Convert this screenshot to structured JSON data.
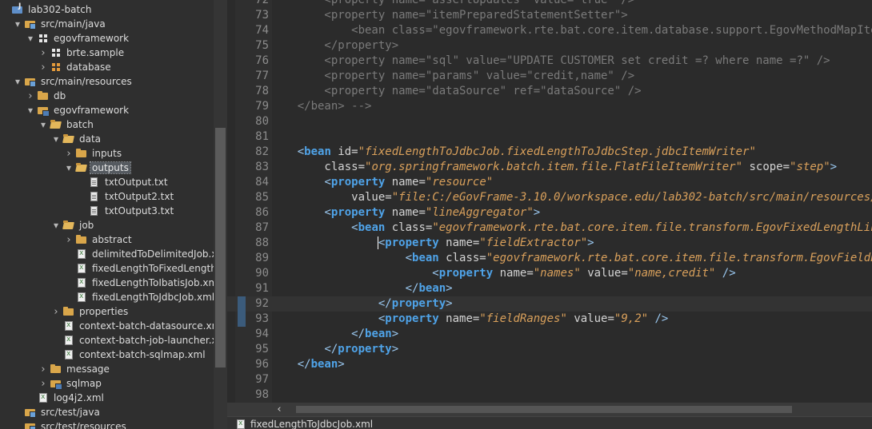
{
  "explorer": {
    "rows": [
      {
        "label": "lab302-batch",
        "icon": "project-icon",
        "twisty": "none",
        "depth": 0
      },
      {
        "label": "src/main/java",
        "icon": "srcfolder-icon",
        "twisty": "expanded",
        "depth": 1
      },
      {
        "label": "egovframework",
        "icon": "package-icon",
        "twisty": "expanded",
        "depth": 2
      },
      {
        "label": "brte.sample",
        "icon": "package-icon",
        "twisty": "collapsed",
        "depth": 3
      },
      {
        "label": "database",
        "icon": "pkg-orange-icon",
        "twisty": "collapsed",
        "depth": 3
      },
      {
        "label": "src/main/resources",
        "icon": "srcfolder-icon",
        "twisty": "expanded",
        "depth": 1
      },
      {
        "label": "db",
        "icon": "folder-icon",
        "twisty": "collapsed",
        "depth": 2
      },
      {
        "label": "egovframework",
        "icon": "linkedfolder-icon",
        "twisty": "expanded",
        "depth": 2
      },
      {
        "label": "batch",
        "icon": "folder-open-icon",
        "twisty": "expanded",
        "depth": 3
      },
      {
        "label": "data",
        "icon": "folder-open-icon",
        "twisty": "expanded",
        "depth": 4
      },
      {
        "label": "inputs",
        "icon": "folder-icon",
        "twisty": "collapsed",
        "depth": 5
      },
      {
        "label": "outputs",
        "icon": "folder-open-icon",
        "twisty": "expanded",
        "depth": 5,
        "selected": true
      },
      {
        "label": "txtOutput.txt",
        "icon": "file-icon",
        "twisty": "none",
        "depth": 6
      },
      {
        "label": "txtOutput2.txt",
        "icon": "file-icon",
        "twisty": "none",
        "depth": 6
      },
      {
        "label": "txtOutput3.txt",
        "icon": "file-icon",
        "twisty": "none",
        "depth": 6
      },
      {
        "label": "job",
        "icon": "folder-open-icon",
        "twisty": "expanded",
        "depth": 4
      },
      {
        "label": "abstract",
        "icon": "folder-icon",
        "twisty": "collapsed",
        "depth": 5
      },
      {
        "label": "delimitedToDelimitedJob.xml",
        "icon": "xml-icon",
        "twisty": "none",
        "depth": 5
      },
      {
        "label": "fixedLengthToFixedLengthJob",
        "icon": "xml-icon",
        "twisty": "none",
        "depth": 5
      },
      {
        "label": "fixedLengthToIbatisJob.xml",
        "icon": "xml-icon",
        "twisty": "none",
        "depth": 5
      },
      {
        "label": "fixedLengthToJdbcJob.xml",
        "icon": "xml-icon",
        "twisty": "none",
        "depth": 5
      },
      {
        "label": "properties",
        "icon": "folder-icon",
        "twisty": "collapsed",
        "depth": 4
      },
      {
        "label": "context-batch-datasource.xml",
        "icon": "xml-icon",
        "twisty": "none",
        "depth": 4
      },
      {
        "label": "context-batch-job-launcher.xml",
        "icon": "xml-icon",
        "twisty": "none",
        "depth": 4
      },
      {
        "label": "context-batch-sqlmap.xml",
        "icon": "xml-icon",
        "twisty": "none",
        "depth": 4
      },
      {
        "label": "message",
        "icon": "folder-icon",
        "twisty": "collapsed",
        "depth": 3
      },
      {
        "label": "sqlmap",
        "icon": "linkedfolder-icon",
        "twisty": "collapsed",
        "depth": 3
      },
      {
        "label": "log4j2.xml",
        "icon": "xml-icon",
        "twisty": "none",
        "depth": 2
      },
      {
        "label": "src/test/java",
        "icon": "srcfolder-icon",
        "twisty": "none",
        "depth": 1
      },
      {
        "label": "src/test/resources",
        "icon": "srcfolder-icon",
        "twisty": "none",
        "depth": 1
      }
    ]
  },
  "editor": {
    "current_line": 92,
    "changed_lines": [
      92,
      93
    ],
    "lines": [
      {
        "n": "72",
        "tokens": [
          [
            "c-comment",
            "        <property name=\"assertUpdates\" value=\"true\" />"
          ]
        ]
      },
      {
        "n": "73",
        "tokens": [
          [
            "c-comment",
            "        <property name=\"itemPreparedStatementSetter\">"
          ]
        ]
      },
      {
        "n": "74",
        "tokens": [
          [
            "c-comment",
            "            <bean class=\"egovframework.rte.bat.core.item.database.support.EgovMethodMapItem"
          ]
        ]
      },
      {
        "n": "75",
        "tokens": [
          [
            "c-comment",
            "        </property>"
          ]
        ]
      },
      {
        "n": "76",
        "tokens": [
          [
            "c-comment",
            "        <property name=\"sql\" value=\"UPDATE CUSTOMER set credit =? where name =?\" />"
          ]
        ]
      },
      {
        "n": "77",
        "tokens": [
          [
            "c-comment",
            "        <property name=\"params\" value=\"credit,name\" />"
          ]
        ]
      },
      {
        "n": "78",
        "tokens": [
          [
            "c-comment",
            "        <property name=\"dataSource\" ref=\"dataSource\" />"
          ]
        ]
      },
      {
        "n": "79",
        "tokens": [
          [
            "c-comment",
            "    </bean> -->"
          ]
        ]
      },
      {
        "n": "80",
        "tokens": []
      },
      {
        "n": "81",
        "tokens": []
      },
      {
        "n": "82",
        "tokens": [
          [
            "c-attr",
            "    "
          ],
          [
            "c-punct",
            "<"
          ],
          [
            "c-tag",
            "bean"
          ],
          [
            "c-attr",
            " id="
          ],
          [
            "c-val",
            "\"fixedLengthToJdbcJob.fixedLengthToJdbcStep.jdbcItemWriter\""
          ]
        ]
      },
      {
        "n": "83",
        "tokens": [
          [
            "c-attr",
            "        class="
          ],
          [
            "c-val",
            "\"org.springframework.batch.item.file.FlatFileItemWriter\""
          ],
          [
            "c-attr",
            " scope="
          ],
          [
            "c-val",
            "\"step\""
          ],
          [
            "c-punct",
            ">"
          ]
        ]
      },
      {
        "n": "84",
        "tokens": [
          [
            "c-attr",
            "        "
          ],
          [
            "c-punct",
            "<"
          ],
          [
            "c-tag",
            "property"
          ],
          [
            "c-attr",
            " name="
          ],
          [
            "c-val",
            "\"resource\""
          ]
        ]
      },
      {
        "n": "85",
        "tokens": [
          [
            "c-attr",
            "            value="
          ],
          [
            "c-val",
            "\"file:C:/eGovFrame-3.10.0/workspace.edu/lab302-batch/src/main/resources/egov"
          ]
        ]
      },
      {
        "n": "86",
        "tokens": [
          [
            "c-attr",
            "        "
          ],
          [
            "c-punct",
            "<"
          ],
          [
            "c-tag",
            "property"
          ],
          [
            "c-attr",
            " name="
          ],
          [
            "c-val",
            "\"lineAggregator\""
          ],
          [
            "c-punct",
            ">"
          ]
        ]
      },
      {
        "n": "87",
        "tokens": [
          [
            "c-attr",
            "            "
          ],
          [
            "c-punct",
            "<"
          ],
          [
            "c-tag",
            "bean"
          ],
          [
            "c-attr",
            " class="
          ],
          [
            "c-val",
            "\"egovframework.rte.bat.core.item.file.transform.EgovFixedLengthLine"
          ]
        ]
      },
      {
        "n": "88",
        "tokens": [
          [
            "c-attr",
            "                "
          ],
          [
            "cursor",
            ""
          ],
          [
            "c-punct",
            "<"
          ],
          [
            "c-tag",
            "property"
          ],
          [
            "c-attr",
            " name="
          ],
          [
            "c-val",
            "\"fieldExtractor\""
          ],
          [
            "c-punct",
            ">"
          ]
        ]
      },
      {
        "n": "89",
        "tokens": [
          [
            "c-attr",
            "                    "
          ],
          [
            "c-punct",
            "<"
          ],
          [
            "c-tag",
            "bean"
          ],
          [
            "c-attr",
            " class="
          ],
          [
            "c-val",
            "\"egovframework.rte.bat.core.item.file.transform.EgovFieldExtr"
          ]
        ]
      },
      {
        "n": "90",
        "tokens": [
          [
            "c-attr",
            "                        "
          ],
          [
            "c-punct",
            "<"
          ],
          [
            "c-tag",
            "property"
          ],
          [
            "c-attr",
            " name="
          ],
          [
            "c-val",
            "\"names\""
          ],
          [
            "c-attr",
            " value="
          ],
          [
            "c-val",
            "\"name,credit\""
          ],
          [
            "c-attr",
            " "
          ],
          [
            "c-punct",
            "/>"
          ]
        ]
      },
      {
        "n": "91",
        "tokens": [
          [
            "c-attr",
            "                    "
          ],
          [
            "c-punct",
            "</"
          ],
          [
            "c-tag",
            "bean"
          ],
          [
            "c-punct",
            ">"
          ]
        ]
      },
      {
        "n": "92",
        "tokens": [
          [
            "c-attr",
            "                "
          ],
          [
            "c-punct",
            "</"
          ],
          [
            "c-tag",
            "property"
          ],
          [
            "c-punct",
            ">"
          ]
        ]
      },
      {
        "n": "93",
        "tokens": [
          [
            "c-attr",
            "                "
          ],
          [
            "c-punct",
            "<"
          ],
          [
            "c-tag",
            "property"
          ],
          [
            "c-attr",
            " name="
          ],
          [
            "c-val",
            "\"fieldRanges\""
          ],
          [
            "c-attr",
            " value="
          ],
          [
            "c-val",
            "\"9,2\""
          ],
          [
            "c-attr",
            " "
          ],
          [
            "c-punct",
            "/>"
          ]
        ]
      },
      {
        "n": "94",
        "tokens": [
          [
            "c-attr",
            "            "
          ],
          [
            "c-punct",
            "</"
          ],
          [
            "c-tag",
            "bean"
          ],
          [
            "c-punct",
            ">"
          ]
        ]
      },
      {
        "n": "95",
        "tokens": [
          [
            "c-attr",
            "        "
          ],
          [
            "c-punct",
            "</"
          ],
          [
            "c-tag",
            "property"
          ],
          [
            "c-punct",
            ">"
          ]
        ]
      },
      {
        "n": "96",
        "tokens": [
          [
            "c-attr",
            "    "
          ],
          [
            "c-punct",
            "</"
          ],
          [
            "c-tag",
            "bean"
          ],
          [
            "c-punct",
            ">"
          ]
        ]
      },
      {
        "n": "97",
        "tokens": []
      },
      {
        "n": "98",
        "tokens": []
      }
    ]
  },
  "hscroll": {
    "left_arrow": "‹"
  },
  "tab": {
    "label": "fixedLengthToJdbcJob.xml",
    "icon": "xml-icon"
  }
}
